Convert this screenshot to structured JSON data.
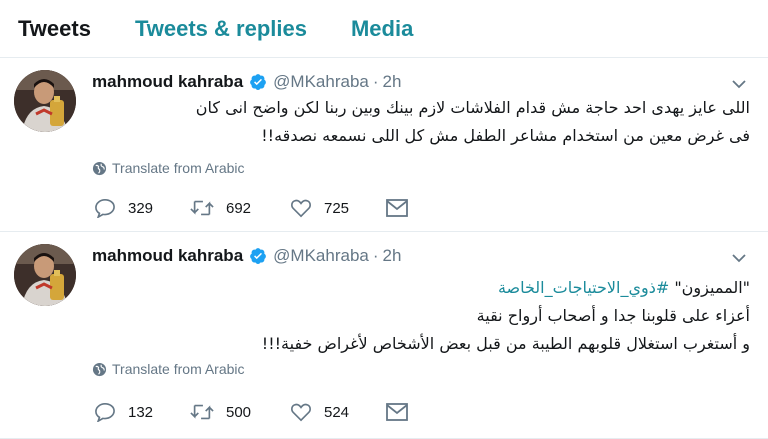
{
  "tabs": {
    "tweets": "Tweets",
    "tweets_replies": "Tweets & replies",
    "media": "Media"
  },
  "tweets": [
    {
      "name": "mahmoud kahraba",
      "handle": "@MKahraba",
      "separator": "·",
      "time": "2h",
      "text_lines": [
        "اللى عايز يهدى احد حاجة مش قدام الفلاشات لازم بينك وبين ربنا لكن واضح انى كان",
        "فى غرض معين من استخدام مشاعر الطفل مش كل اللى نسمعه نصدقه!!"
      ],
      "translate": "Translate from Arabic",
      "replies": "329",
      "retweets": "692",
      "likes": "725"
    },
    {
      "name": "mahmoud kahraba",
      "handle": "@MKahraba",
      "separator": "·",
      "time": "2h",
      "text_prefix": "\"المميزون\" ",
      "hashtag": "#ذوي_الاحتياجات_الخاصة",
      "text_lines": [
        "أعزاء على قلوبنا جدا و أصحاب أرواح نقية",
        "و أستغرب استغلال قلوبهم الطيبة من قبل بعض الأشخاص لأغراض خفية!!!"
      ],
      "translate": "Translate from Arabic",
      "replies": "132",
      "retweets": "500",
      "likes": "524"
    }
  ],
  "icons": {
    "verified": "verified-badge-icon",
    "caret": "chevron-down-icon",
    "globe": "globe-icon",
    "reply": "reply-icon",
    "retweet": "retweet-icon",
    "like": "heart-icon",
    "message": "envelope-icon"
  },
  "colors": {
    "accent": "#1b8b9b",
    "verified": "#1da1f2",
    "muted": "#657786",
    "text": "#14171a"
  }
}
